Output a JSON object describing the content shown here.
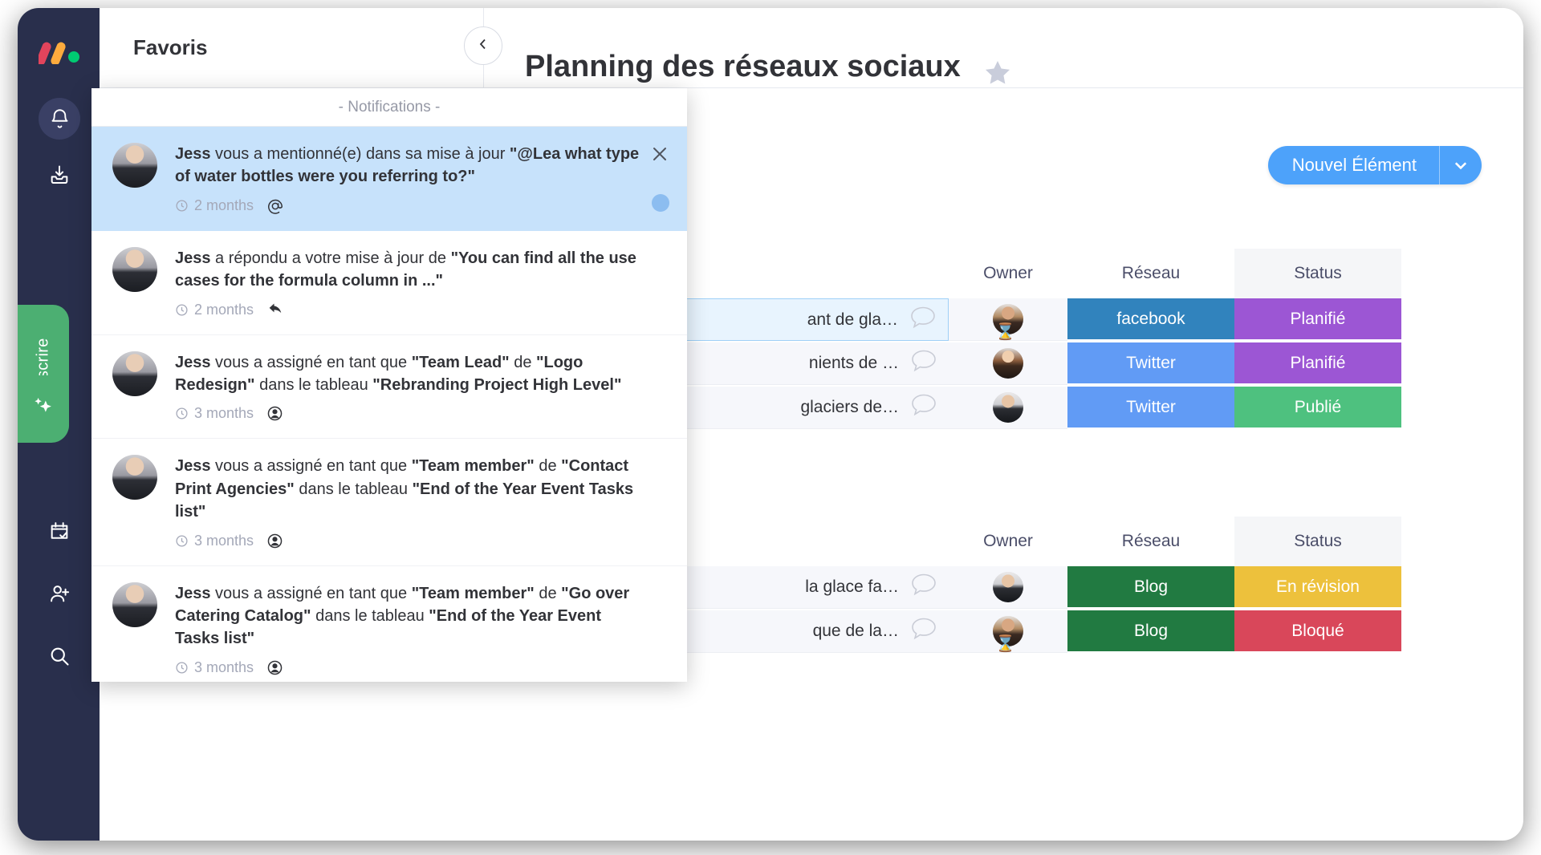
{
  "app": {
    "logo": "monday-logo",
    "rail_items": [
      {
        "name": "notifications-bell",
        "icon": "bell-icon",
        "active": true
      },
      {
        "name": "inbox",
        "icon": "inbox-download-icon",
        "active": false
      },
      {
        "name": "calendar",
        "icon": "calendar-check-icon",
        "active": false
      },
      {
        "name": "invite-member",
        "icon": "person-add-icon",
        "active": false
      },
      {
        "name": "search",
        "icon": "search-icon",
        "active": false
      }
    ],
    "subscribe_tab": {
      "label": "Souscrire",
      "icon": "sparkles-icon",
      "color": "#4caf72"
    }
  },
  "header": {
    "favorites_label": "Favoris",
    "collapse_icon": "chevron-left-icon",
    "board_title": "Planning des réseaux sociaux",
    "star_icon": "star-icon"
  },
  "toolbar": {
    "new_item_label": "Nouvel Élément",
    "new_item_caret_icon": "chevron-down-icon",
    "accent_color": "#4da2fa"
  },
  "notifications": {
    "panel_title": "- Notifications -",
    "close_icon": "close-icon",
    "items": [
      {
        "author": "Jess",
        "unread": true,
        "segments": [
          {
            "t": "Jess",
            "b": true
          },
          {
            "t": " vous a mentionné(e) dans sa mise à jour ",
            "b": false
          },
          {
            "t": "\"@Lea  what type of water bottles were you referring to?\"",
            "b": true
          }
        ],
        "time": "2 months",
        "kind_icon": "mention-at-icon",
        "kind_glyph": "@"
      },
      {
        "author": "Jess",
        "unread": false,
        "segments": [
          {
            "t": "Jess",
            "b": true
          },
          {
            "t": " a répondu a votre mise à jour de ",
            "b": false
          },
          {
            "t": "\"You can find all the use cases for the formula column in ...\"",
            "b": true
          }
        ],
        "time": "2 months",
        "kind_icon": "reply-arrow-icon",
        "kind_glyph": "↩"
      },
      {
        "author": "Jess",
        "unread": false,
        "segments": [
          {
            "t": "Jess",
            "b": true
          },
          {
            "t": " vous a assigné en tant que ",
            "b": false
          },
          {
            "t": "\"Team Lead\"",
            "b": true
          },
          {
            "t": " de ",
            "b": false
          },
          {
            "t": "\"Logo Redesign\"",
            "b": true
          },
          {
            "t": " dans le tableau ",
            "b": false
          },
          {
            "t": "\"Rebranding Project High Level\"",
            "b": true
          }
        ],
        "time": "3 months",
        "kind_icon": "person-circle-icon",
        "kind_glyph": "◉"
      },
      {
        "author": "Jess",
        "unread": false,
        "segments": [
          {
            "t": "Jess",
            "b": true
          },
          {
            "t": " vous a assigné en tant que ",
            "b": false
          },
          {
            "t": "\"Team member\"",
            "b": true
          },
          {
            "t": " de ",
            "b": false
          },
          {
            "t": "\"Contact Print Agencies\"",
            "b": true
          },
          {
            "t": " dans le tableau ",
            "b": false
          },
          {
            "t": "\"End of the Year Event Tasks list\"",
            "b": true
          }
        ],
        "time": "3 months",
        "kind_icon": "person-circle-icon",
        "kind_glyph": "◉"
      },
      {
        "author": "Jess",
        "unread": false,
        "segments": [
          {
            "t": "Jess",
            "b": true
          },
          {
            "t": " vous a assigné en tant que ",
            "b": false
          },
          {
            "t": "\"Team member\"",
            "b": true
          },
          {
            "t": " de ",
            "b": false
          },
          {
            "t": "\"Go over Catering Catalog\"",
            "b": true
          },
          {
            "t": " dans le tableau ",
            "b": false
          },
          {
            "t": "\"End of the Year Event Tasks list\"",
            "b": true
          }
        ],
        "time": "3 months",
        "kind_icon": "person-circle-icon",
        "kind_glyph": "◉"
      }
    ]
  },
  "board": {
    "columns": [
      "Owner",
      "Réseau",
      "Status"
    ],
    "groups": [
      {
        "rows": [
          {
            "name": "ant de gla…",
            "selected": true,
            "avatar": "a2",
            "hourglass": true,
            "reseau": "facebook",
            "reseau_color": "#3183bd",
            "status": "Planifié",
            "status_color": "#9c56d4"
          },
          {
            "name": "nients de …",
            "selected": false,
            "avatar": "a4",
            "hourglass": false,
            "reseau": "Twitter",
            "reseau_color": "#619bf5",
            "status": "Planifié",
            "status_color": "#9c56d4"
          },
          {
            "name": "glaciers de…",
            "selected": false,
            "avatar": "a3",
            "hourglass": false,
            "reseau": "Twitter",
            "reseau_color": "#619bf5",
            "status": "Publié",
            "status_color": "#4ec17f"
          }
        ]
      },
      {
        "rows": [
          {
            "name": "la glace fa…",
            "selected": false,
            "avatar": "a3",
            "hourglass": false,
            "reseau": "Blog",
            "reseau_color": "#217a41",
            "status": "En révision",
            "status_color": "#edc13c"
          },
          {
            "name": "que de la…",
            "selected": false,
            "avatar": "a2",
            "hourglass": true,
            "reseau": "Blog",
            "reseau_color": "#217a41",
            "status": "Bloqué",
            "status_color": "#d9475a"
          }
        ]
      }
    ]
  }
}
